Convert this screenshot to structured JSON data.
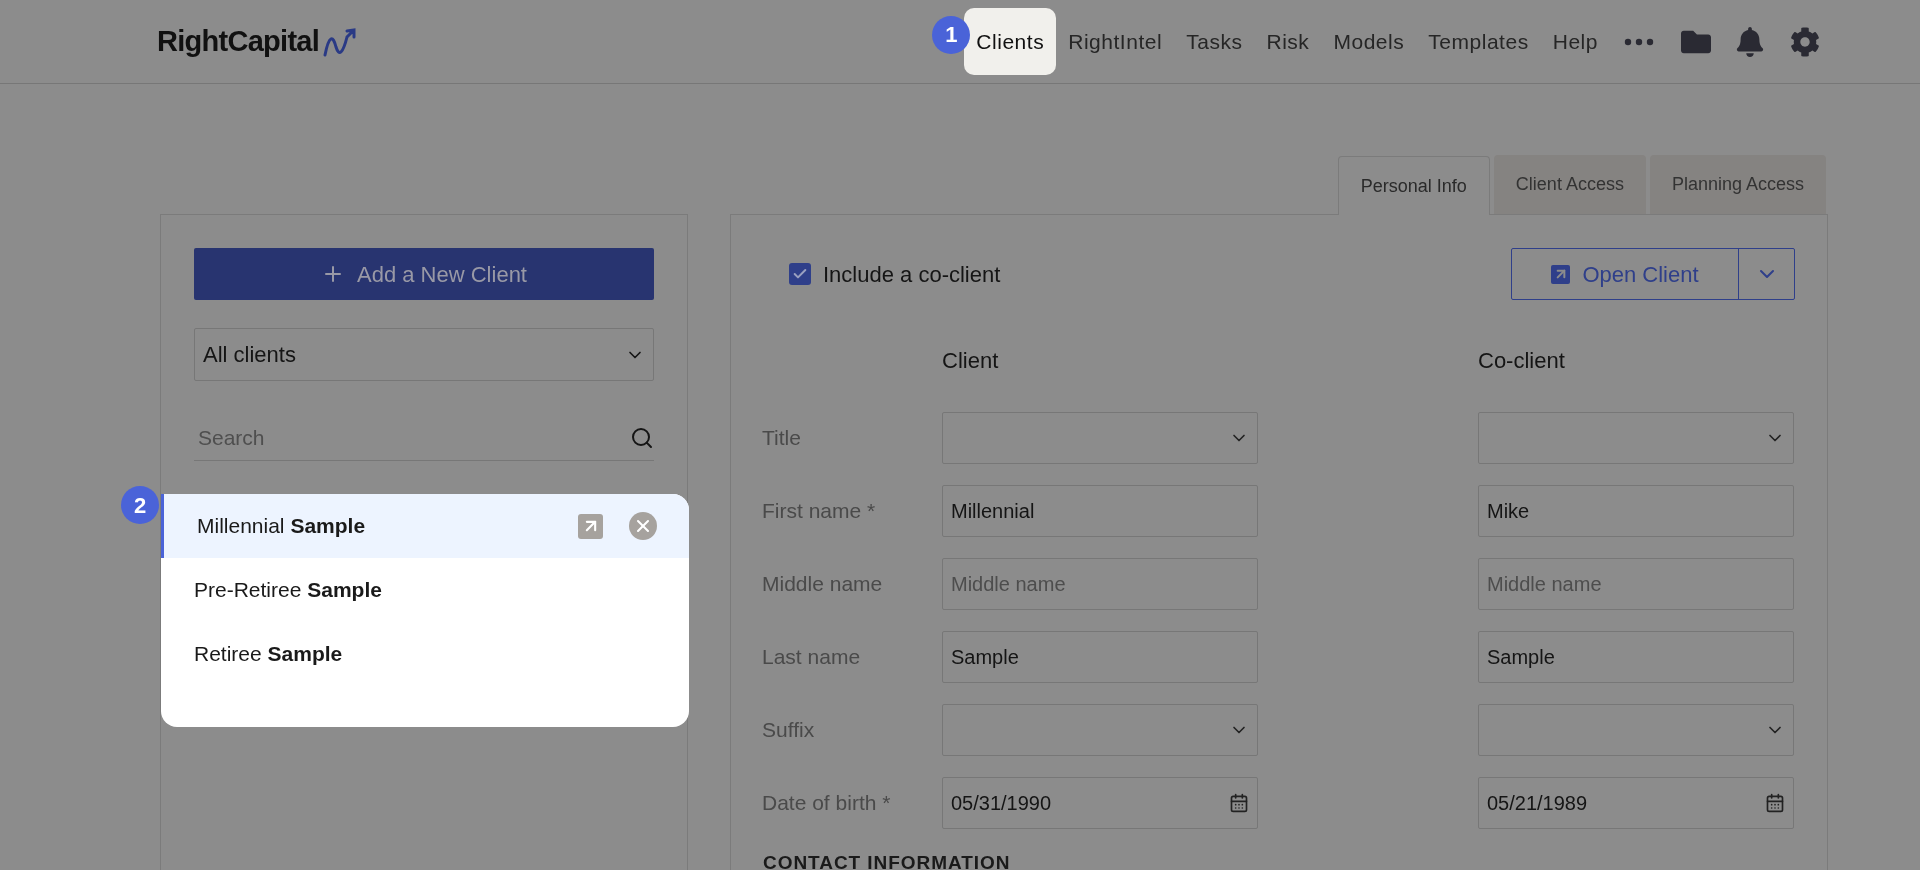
{
  "header": {
    "logo": "RightCapital",
    "nav": [
      {
        "label": "Clients",
        "selected": true,
        "step": "1"
      },
      {
        "label": "RightIntel",
        "selected": false
      },
      {
        "label": "Tasks",
        "selected": false
      },
      {
        "label": "Risk",
        "selected": false
      },
      {
        "label": "Models",
        "selected": false
      },
      {
        "label": "Templates",
        "selected": false
      },
      {
        "label": "Help",
        "selected": false
      }
    ]
  },
  "client_list": {
    "add_button": "Add a New Client",
    "filter": "All clients",
    "search": {
      "placeholder": "Search"
    },
    "step": "2",
    "clients": [
      {
        "name": "Millennial **Sample**",
        "selected": true
      },
      {
        "name": "Pre-Retiree **Sample**",
        "selected": false
      },
      {
        "name": "Retiree **Sample**",
        "selected": false
      }
    ]
  },
  "tabs": [
    {
      "label": "Personal Info",
      "selected": true
    },
    {
      "label": "Client Access",
      "selected": false
    },
    {
      "label": "Planning Access",
      "selected": false
    }
  ],
  "form": {
    "include_co_client": {
      "label": "Include a co-client",
      "checked": true
    },
    "open_button": "Open Client",
    "columns": [
      "Client",
      "Co-client"
    ],
    "rows": [
      {
        "label": "Title",
        "kind": "select"
      },
      {
        "label": "First name *",
        "kind": "text",
        "client": {
          "value": "Millennial"
        },
        "co_client": {
          "value": "Mike"
        }
      },
      {
        "label": "Middle name",
        "kind": "text",
        "client": {
          "placeholder": "Middle name"
        },
        "co_client": {
          "placeholder": "Middle name"
        }
      },
      {
        "label": "Last name",
        "kind": "text",
        "client": {
          "value": "Sample"
        },
        "co_client": {
          "value": "Sample"
        }
      },
      {
        "label": "Suffix",
        "kind": "select"
      },
      {
        "label": "Date of birth *",
        "kind": "date",
        "client": {
          "value": "05/31/1990"
        },
        "co_client": {
          "value": "05/21/1989"
        }
      }
    ],
    "section_heading": "CONTACT INFORMATION"
  }
}
